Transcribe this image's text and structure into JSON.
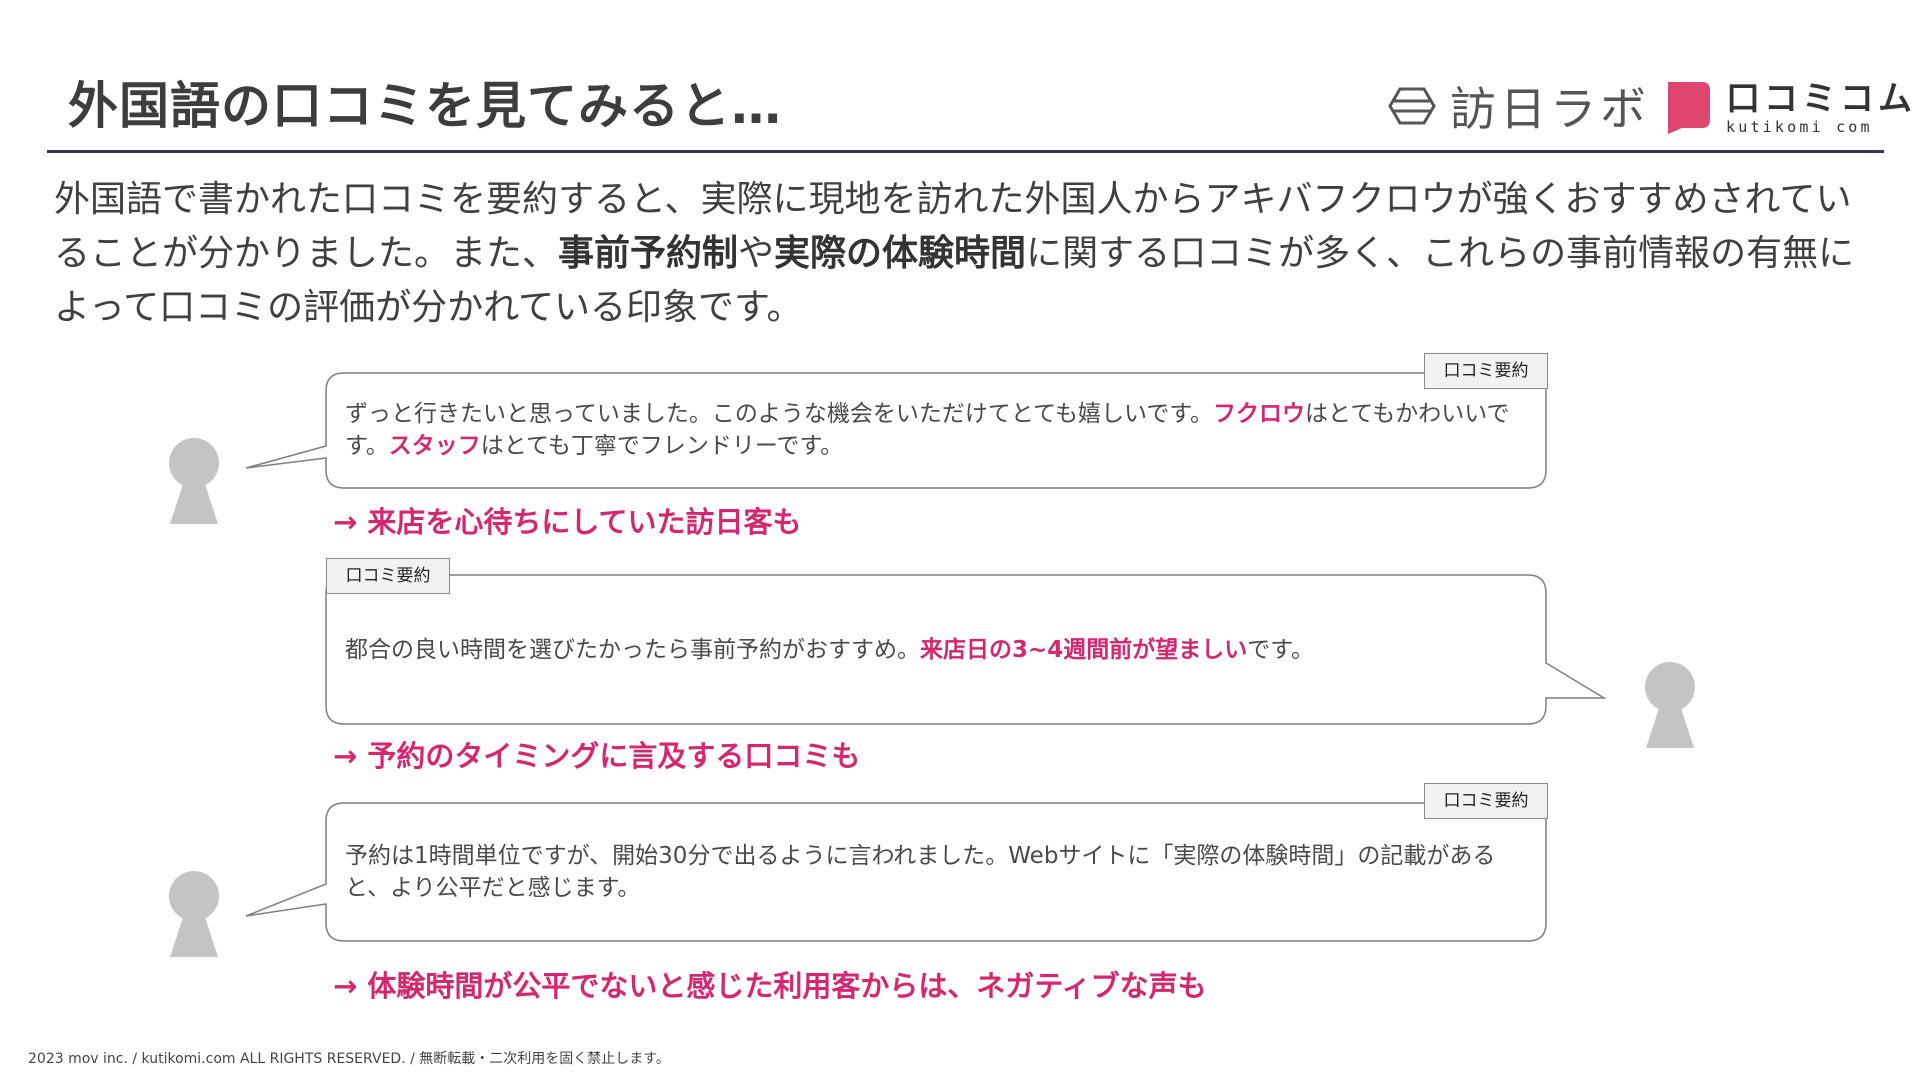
{
  "title": "外国語の口コミを見てみると…",
  "logos": {
    "houjin_labo": "訪日ラボ",
    "kutikomi_main": "口コミコム",
    "kutikomi_sub": "kutikomi com"
  },
  "intro": {
    "part1": "外国語で書かれた口コミを要約すると、実際に現地を訪れた外国人からアキバフクロウが強くおすすめされていることが分かりました。また、",
    "bold1": "事前予約制",
    "part2": "や",
    "bold2": "実際の体験時間",
    "part3": "に関する口コミが多く、これらの事前情報の有無によって口コミの評価が分かれている印象です。"
  },
  "reviews": [
    {
      "label": "口コミ要約",
      "t1": "ずっと行きたいと思っていました。このような機会をいただけてとても嬉しいです。",
      "h1": "フクロウ",
      "t2": "はとてもかわいいです。",
      "h2": "スタッフ",
      "t3": "はとても丁寧でフレンドリーです。",
      "conclusion": "→ 来店を心待ちにしていた訪日客も"
    },
    {
      "label": "口コミ要約",
      "t1": "都合の良い時間を選びたかったら事前予約がおすすめ。",
      "h1": "来店日の3~4週間前が望ましい",
      "t2": "です。",
      "conclusion": "→ 予約のタイミングに言及する口コミも"
    },
    {
      "label": "口コミ要約",
      "t1": "予約は1時間単位ですが、開始30分で出るように言われました。Webサイトに「実際の体験時間」の記載があると、より公平だと感じます。",
      "conclusion": "→ 体験時間が公平でないと感じた利用客からは、ネガティブな声も"
    }
  ],
  "footer": "2023 mov inc. / kutikomi.com ALL RIGHTS RESERVED. / 無断転載・二次利用を固く禁止します。",
  "colors": {
    "accent": "#d6266f",
    "rule": "#2f3a52",
    "person": "#c4c4c4",
    "kutikomi_mark": "#e0456f"
  },
  "icons": [
    "person-icon",
    "speech-bubble",
    "hexagon-logo-icon",
    "kutikomi-logo-icon"
  ]
}
